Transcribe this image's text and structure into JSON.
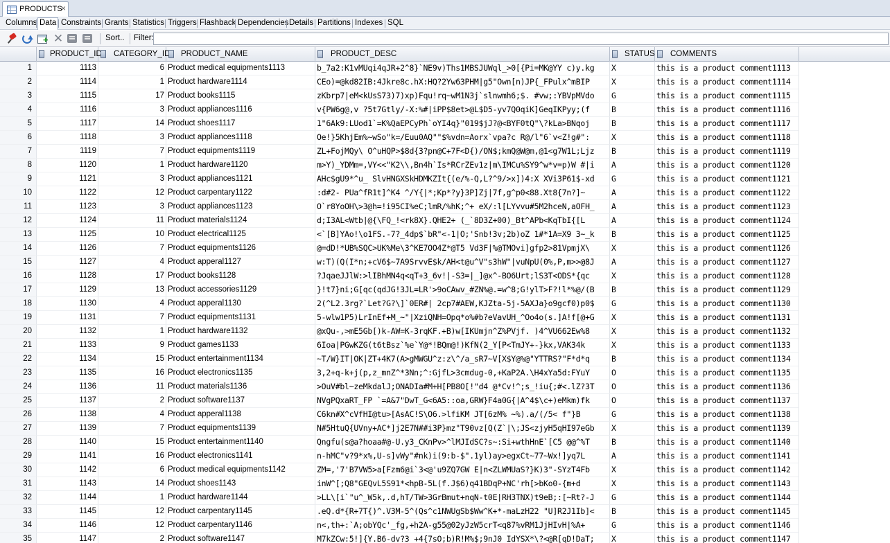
{
  "doc_tab": {
    "title": "PRODUCTS",
    "close_glyph": "×",
    "icon": "table-icon"
  },
  "sub_tabs": [
    "Columns",
    "Data",
    "Constraints",
    "Grants",
    "Statistics",
    "Triggers",
    "Flashback",
    "Dependencies",
    "Details",
    "Partitions",
    "Indexes",
    "SQL"
  ],
  "active_sub_tab": "Data",
  "toolbar": {
    "icons": [
      "pin-icon",
      "refresh-icon",
      "insert-row-icon",
      "delete-row-icon",
      "commit-icon",
      "rollback-icon"
    ],
    "sort_label": "Sort..",
    "filter_label": "Filter:",
    "filter_value": ""
  },
  "grid": {
    "columns": [
      "PRODUCT_ID",
      "CATEGORY_ID",
      "PRODUCT_NAME",
      "PRODUCT_DESC",
      "STATUS",
      "COMMENTS"
    ],
    "rows": [
      [
        "1",
        "1113",
        "6",
        "Product medical equipments1113",
        "b_7a2:K1vMUqi4qJR+2^8}`NE9v)Ths1MBSJUWql_>0[{Pi=MK@YY c)y.kg",
        "X",
        "this is a product comment1113"
      ],
      [
        "2",
        "1114",
        "1",
        "Product hardware1114",
        "CEo)=@kd82IB:4Jkre8c.hX:HQ?2Yw63PHM|g5\"Own[n)JP{_FPulx^mBIP",
        "X",
        "this is a product comment1114"
      ],
      [
        "3",
        "1115",
        "17",
        "Product books1115",
        "zKbrp7|eM<kUsS73)7)xp)Fqu!rq~wM1N3j`slnwmh6;$. #vw;:YBVpMVdo",
        "G",
        "this is a product comment1115"
      ],
      [
        "4",
        "1116",
        "3",
        "Product appliances1116",
        "v{PW6g@,v ?5t7Gtly/-X:%#|iPP$8et>@L$D5-yv7Q0qiK]GeqIKPyy;(f",
        "B",
        "this is a product comment1116"
      ],
      [
        "5",
        "1117",
        "14",
        "Product shoes1117",
        "1\"6Ak9:LUod1`=K%QaEPCyPh`oYI4q}\"019$jJ?@<BYF0tQ\"\\?kLa>BNqoj",
        "B",
        "this is a product comment1117"
      ],
      [
        "6",
        "1118",
        "3",
        "Product appliances1118",
        "Oe!}5KhjEm%~wSo\"k=/Euu0AQ\"\"$%vdn=Aorx`vpa?c R@/l\"6`v<Z!g#\":",
        "X",
        "this is a product comment1118"
      ],
      [
        "7",
        "1119",
        "7",
        "Product equipments1119",
        "ZL+FojMQy\\ O^uHQP>$8d{3?pn@C+7F<D{)/ON$;kmQ@W@m,@1<g7W1L;Ljz",
        "B",
        "this is a product comment1119"
      ],
      [
        "8",
        "1120",
        "1",
        "Product hardware1120",
        "m>Y)_YDMm=,VY<<\"K2\\\\,Bn4h`Is*RCrZEv1z|m\\IMCu%SY9^w*v=p)W #|i",
        "A",
        "this is a product comment1120"
      ],
      [
        "9",
        "1121",
        "3",
        "Product appliances1121",
        "AHc$gU9*^u_ SlvHNGXSkHDMKZIt{(e/%-Q,L?^9/>x])4:X XVi3P61$-xd",
        "G",
        "this is a product comment1121"
      ],
      [
        "10",
        "1122",
        "12",
        "Product carpentary1122",
        ":d#2- PUa^fR1t]^K4 ^/Y{|*;Kp*?y}3P]Zj|7f,g^p0<88.Xt8{7n?]~",
        "A",
        "this is a product comment1122"
      ],
      [
        "11",
        "1123",
        "3",
        "Product appliances1123",
        "O`r8YoOH\\>3@h=!i95CI%eC;lmR/%hK;^+ eX/:l[LYvvu#5M2hceN,aOFH_",
        "A",
        "this is a product comment1123"
      ],
      [
        "12",
        "1124",
        "11",
        "Product materials1124",
        "d;I3AL<Wtb|@{\\FQ_!<rk8X}.QHE2+ (_`8D3Z+00)_Bt^APb<KqTbI{[L",
        "A",
        "this is a product comment1124"
      ],
      [
        "13",
        "1125",
        "10",
        "Product electrical1125",
        "<`[B]YAo!\\o1FS.-7?_4dp$`bR\"<-1|O;'Snb!3v;2b)oZ 1#*1A=X9 3~_k",
        "B",
        "this is a product comment1125"
      ],
      [
        "14",
        "1126",
        "7",
        "Product equipments1126",
        "@=dD!*UB%SQC>UK%Me\\3^KE7OO4Z*@T5 Vd3F|%@TMOvi]gfp2>81VpmjX\\",
        "X",
        "this is a product comment1126"
      ],
      [
        "15",
        "1127",
        "4",
        "Product apperal1127",
        "w:T)(Q(I*n;+cV6$~7A9SrvvE$k/AH<t@u^V\"s3hW\"|vuNpU(0%,P,m>>@8J",
        "A",
        "this is a product comment1127"
      ],
      [
        "16",
        "1128",
        "17",
        "Product books1128",
        "?JqaeJJlW:>lIBhMN4q<qT+3_6v!|-S3=|_]@x^-BO6Urt;lS3T<ODS*{qc",
        "X",
        "this is a product comment1128"
      ],
      [
        "17",
        "1129",
        "13",
        "Product accessories1129",
        "}!t7}ni;G[qc(qdJG!3JL=LR'>9oCAwv_#ZN%@.=w^8;G!ylT>F?!l*%@/(B",
        "B",
        "this is a product comment1129"
      ],
      [
        "18",
        "1130",
        "4",
        "Product apperal1130",
        "2(^L2.3rg?`Let?G?\\]`0ER#| 2cp7#AEW,KJZta-5j-5AXJa}o9gcf0)p0$",
        "G",
        "this is a product comment1130"
      ],
      [
        "19",
        "1131",
        "7",
        "Product equipments1131",
        "5-wlw1P5)LrInEf+M_~\"|XziQNH=Opq*o%#b?eVavUH_^Oo4o(s.]A!f[@+G",
        "X",
        "this is a product comment1131"
      ],
      [
        "20",
        "1132",
        "1",
        "Product hardware1132",
        "@xQu-,>mE5Gb[)k-AW=K-3rqKF.+B)w[IKUmjn^Z%PVjf. )4^VU662Ew%8",
        "X",
        "this is a product comment1132"
      ],
      [
        "21",
        "1133",
        "9",
        "Product games1133",
        "6Ioa|PGwKZG(t6tBsz`%e`Y@*!BQm@!)KfN(2_Y[P<TmJY+-}kx,VAK34k",
        "X",
        "this is a product comment1133"
      ],
      [
        "22",
        "1134",
        "15",
        "Product entertainment1134",
        "~T/W}IT|OK|ZT+4K7(A>gMWGU^z:z\\^/a_sR7~V[X$Y@%@\"YTTRS?\"F*d*q",
        "B",
        "this is a product comment1134"
      ],
      [
        "23",
        "1135",
        "16",
        "Product electronics1135",
        "3,2+q-k+j(p,z_mnZ^*3Nn;^:GjfL>3cmdug-0,+KaP2A.\\H4xYa5d:FYuY",
        "O",
        "this is a product comment1135"
      ],
      [
        "24",
        "1136",
        "11",
        "Product materials1136",
        ">OuV#bl~zeMkdalJ;ONADIa#M+H[PB8O[!\"d4 @*Cv!^;s_!iu{;#<.lZ?3T",
        "O",
        "this is a product comment1136"
      ],
      [
        "25",
        "1137",
        "2",
        "Product software1137",
        "NVgPQxaRT_FP `=A&7\"DwT_G<6A5::oa,GRW}F4a0G{|A^4$\\c+)eMkm)fk",
        "O",
        "this is a product comment1137"
      ],
      [
        "26",
        "1138",
        "4",
        "Product apperal1138",
        "C6kn#X^cVfHI@tu>[AsAC!S\\O6.>lfiKM JT[6zM% ~%).a/(/5< f\"}B",
        "G",
        "this is a product comment1138"
      ],
      [
        "27",
        "1139",
        "7",
        "Product equipments1139",
        "N#5HtuQ{UVny+AC*]j2E7N##i3P}mz\"T90vz[Q(Z`|\\;JS<zjyH5qHI97eGb",
        "X",
        "this is a product comment1139"
      ],
      [
        "28",
        "1140",
        "15",
        "Product entertainment1140",
        "Qngfu(s@a?hoaa#@-U.y3_CKnPv>^lMJIdSC?s~:Si+wthHnE`[C5 @@^%T",
        "B",
        "this is a product comment1140"
      ],
      [
        "29",
        "1141",
        "16",
        "Product electronics1141",
        "n-hMC\"v?9*x%,U-s]vWy\"#nk)i(9:b-$\".1yl)ay>egxCt~77~Wx!]yq7L",
        "A",
        "this is a product comment1141"
      ],
      [
        "30",
        "1142",
        "6",
        "Product medical equipments1142",
        "ZM=,'7'B7VW5>a[Fzm6@i`3<@'u9ZQ7GW E|n<ZLWMUaS?}K)3\"-SYzT4Fb",
        "X",
        "this is a product comment1142"
      ],
      [
        "31",
        "1143",
        "14",
        "Product shoes1143",
        "inW^[;Q8\"GEQvL5S91*<hpB-5L(f.J$6)q41BDqP+NC'rh[>bKo0-{m+d",
        "X",
        "this is a product comment1143"
      ],
      [
        "32",
        "1144",
        "1",
        "Product hardware1144",
        ">LL\\[i`\"u^_W5k,.d,hT/TW>3GrBmut+nqN-t0E|RH3TNX)t9eB;:[~Rt?-J",
        "G",
        "this is a product comment1144"
      ],
      [
        "33",
        "1145",
        "12",
        "Product carpentary1145",
        ".eQ.d*{R+7T{)^.V3M-5^(Qs^c1NWUgSb$Ww^K+*-maLzH22 \"U]R2J1Ib]<",
        "B",
        "this is a product comment1145"
      ],
      [
        "34",
        "1146",
        "12",
        "Product carpentary1146",
        "n<,th+:`A;obYQc'_fg,+h2A-g55@02yJzW5crT<q87%vRM1JjHIvH|%A+",
        "G",
        "this is a product comment1146"
      ],
      [
        "35",
        "1147",
        "2",
        "Product software1147",
        "M7kZCw:5!]{Y.B6-dv?3_+4{7sO;b)R!M%$;9nJ0_IdYSX*\\?<@R[qD!DaT;",
        "X",
        "this is a product comment1147"
      ]
    ]
  }
}
